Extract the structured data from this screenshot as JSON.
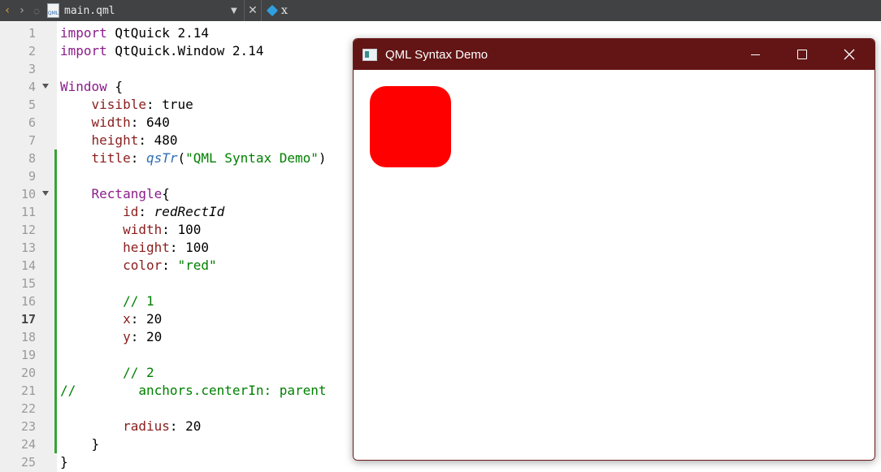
{
  "toolbar": {
    "file_name": "main.qml",
    "file_icon_text": "QML",
    "symbol_name": "x"
  },
  "editor": {
    "current_line": 17,
    "lines": [
      {
        "n": "1",
        "code": "import QtQuick 2.14"
      },
      {
        "n": "2",
        "code": "import QtQuick.Window 2.14"
      },
      {
        "n": "3",
        "code": ""
      },
      {
        "n": "4",
        "code": "Window {",
        "fold": true
      },
      {
        "n": "5",
        "code": "    visible: true"
      },
      {
        "n": "6",
        "code": "    width: 640"
      },
      {
        "n": "7",
        "code": "    height: 480"
      },
      {
        "n": "8",
        "code": "    title: qsTr(\"QML Syntax Demo\")",
        "changed": true
      },
      {
        "n": "9",
        "code": "",
        "changed": true
      },
      {
        "n": "10",
        "code": "    Rectangle{",
        "fold": true,
        "changed": true
      },
      {
        "n": "11",
        "code": "        id: redRectId",
        "changed": true
      },
      {
        "n": "12",
        "code": "        width: 100",
        "changed": true
      },
      {
        "n": "13",
        "code": "        height: 100",
        "changed": true
      },
      {
        "n": "14",
        "code": "        color: \"red\"",
        "changed": true
      },
      {
        "n": "15",
        "code": "",
        "changed": true
      },
      {
        "n": "16",
        "code": "        // 1",
        "changed": true
      },
      {
        "n": "17",
        "code": "        x: 20",
        "changed": true
      },
      {
        "n": "18",
        "code": "        y: 20",
        "changed": true
      },
      {
        "n": "19",
        "code": "",
        "changed": true
      },
      {
        "n": "20",
        "code": "        // 2",
        "changed": true
      },
      {
        "n": "21",
        "code": "//        anchors.centerIn: parent",
        "changed": true
      },
      {
        "n": "22",
        "code": "",
        "changed": true
      },
      {
        "n": "23",
        "code": "        radius: 20",
        "changed": true
      },
      {
        "n": "24",
        "code": "    }",
        "changed": true
      },
      {
        "n": "25",
        "code": "}"
      }
    ]
  },
  "app_window": {
    "title": "QML Syntax Demo",
    "titlebar_color": "#631515",
    "rect_color": "#ff0000"
  }
}
